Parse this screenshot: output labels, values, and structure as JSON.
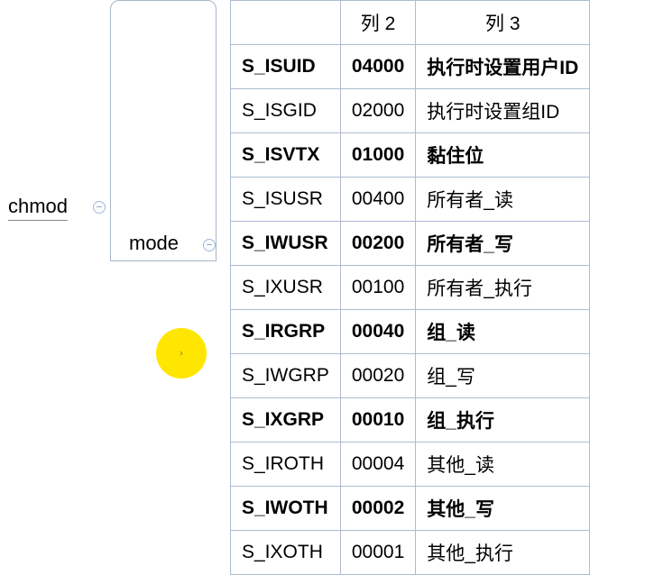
{
  "mindmap": {
    "root_label": "chmod",
    "child_label": "mode"
  },
  "table": {
    "headers": [
      "",
      "列 2",
      "列 3"
    ],
    "rows": [
      {
        "c1": "S_ISUID",
        "c2": "04000",
        "c3": "执行时设置用户ID",
        "bold": true
      },
      {
        "c1": "S_ISGID",
        "c2": "02000",
        "c3": "执行时设置组ID",
        "bold": false
      },
      {
        "c1": "S_ISVTX",
        "c2": "01000",
        "c3": "黏住位",
        "bold": true
      },
      {
        "c1": "S_ISUSR",
        "c2": "00400",
        "c3": "所有者_读",
        "bold": false
      },
      {
        "c1": "S_IWUSR",
        "c2": "00200",
        "c3": "所有者_写",
        "bold": true
      },
      {
        "c1": "S_IXUSR",
        "c2": "00100",
        "c3": "所有者_执行",
        "bold": false
      },
      {
        "c1": "S_IRGRP",
        "c2": "00040",
        "c3": "组_读",
        "bold": true
      },
      {
        "c1": "S_IWGRP",
        "c2": "00020",
        "c3": "组_写",
        "bold": false
      },
      {
        "c1": "S_IXGRP",
        "c2": "00010",
        "c3": "组_执行",
        "bold": true
      },
      {
        "c1": "S_IROTH",
        "c2": "00004",
        "c3": "其他_读",
        "bold": false
      },
      {
        "c1": "S_IWOTH",
        "c2": "00002",
        "c3": "其他_写",
        "bold": true
      },
      {
        "c1": "S_IXOTH",
        "c2": "00001",
        "c3": "其他_执行",
        "bold": false
      }
    ]
  }
}
